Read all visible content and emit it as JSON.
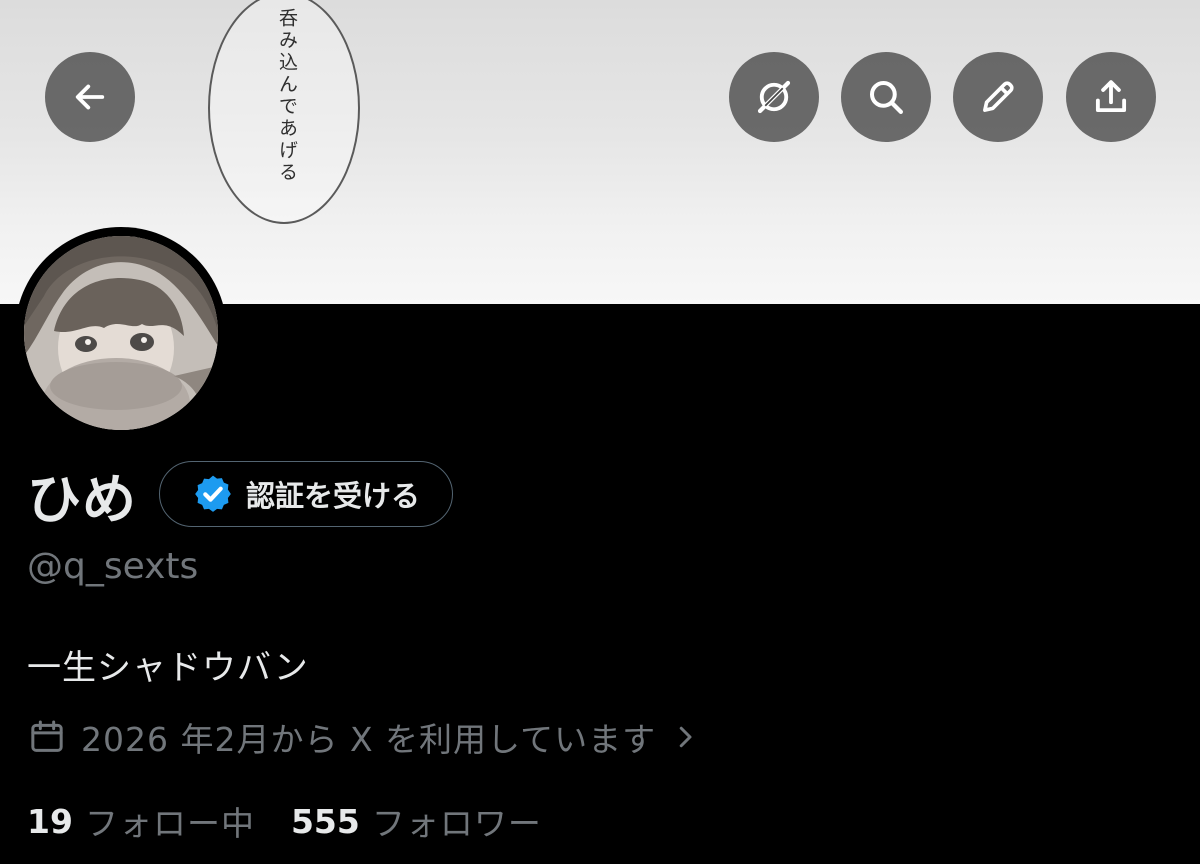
{
  "banner": {
    "speech_text": "呑み込んであげる"
  },
  "header": {
    "back_icon": "arrow-left-icon",
    "grok_icon": "grok-icon",
    "search_icon": "search-icon",
    "edit_icon": "pencil-icon",
    "share_icon": "share-icon"
  },
  "profile": {
    "display_name": "ひめ",
    "verify_button_label": "認証を受ける",
    "handle": "@q_sexts",
    "bio": "一生シャドウバン",
    "joined_text": "2026 年2月から X を利用しています",
    "following_count": "19",
    "following_label": "フォロー中",
    "followers_count": "555",
    "followers_label": "フォロワー"
  },
  "colors": {
    "background": "#000000",
    "text_primary": "#e7e9ea",
    "text_secondary": "#71767b",
    "verified_blue": "#1d9bf0",
    "button_overlay": "#464646"
  }
}
